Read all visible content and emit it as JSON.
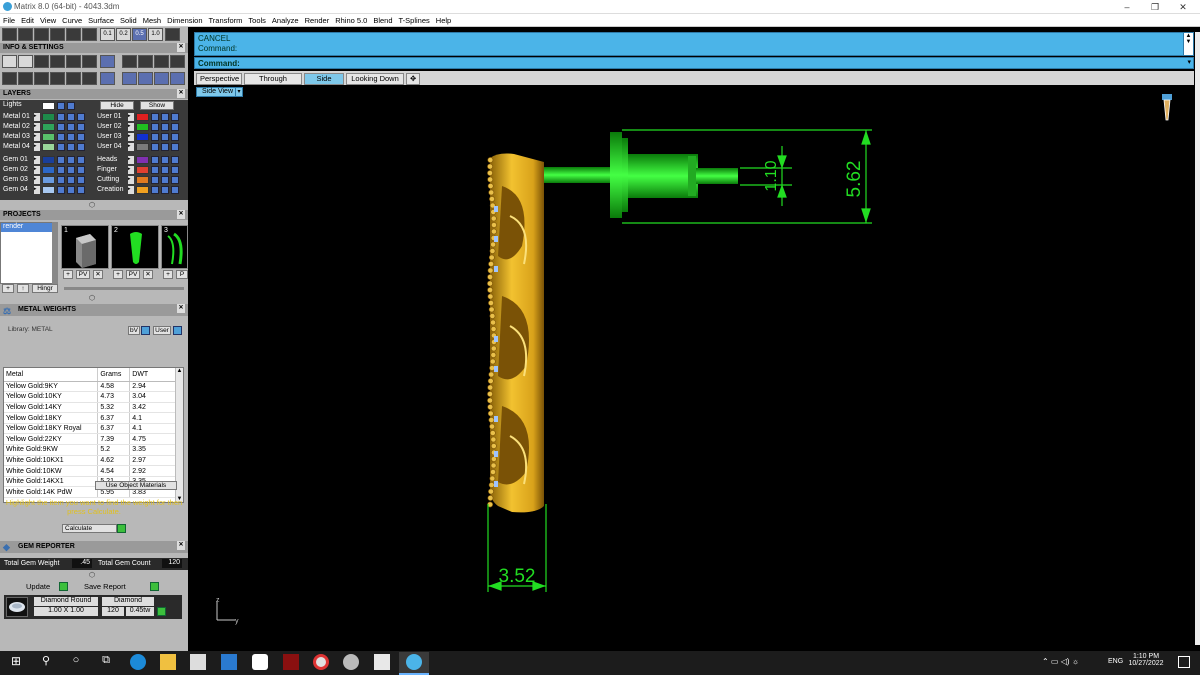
{
  "window": {
    "title": "Matrix 8.0 (64-bit) - 4043.3dm",
    "controls": [
      "–",
      "❐",
      "✕"
    ]
  },
  "menu": [
    "File",
    "Edit",
    "View",
    "Curve",
    "Surface",
    "Solid",
    "Mesh",
    "Dimension",
    "Transform",
    "Tools",
    "Analyze",
    "Render",
    "Rhino 5.0",
    "Blend",
    "T-Splines",
    "Help"
  ],
  "toolbar_numbers": [
    "0.1",
    "0.2",
    "0.5",
    "1.0"
  ],
  "info_settings": {
    "title": "INFO & SETTINGS"
  },
  "layers": {
    "title": "LAYERS",
    "lights_label": "Lights",
    "hide_label": "Hide",
    "show_label": "Show",
    "left": [
      {
        "name": "Metal 01",
        "color": "#1e8a4a"
      },
      {
        "name": "Metal 02",
        "color": "#2fa35a"
      },
      {
        "name": "Metal 03",
        "color": "#59c06a"
      },
      {
        "name": "Metal 04",
        "color": "#9ad89a"
      },
      {
        "name": "Gem 01",
        "color": "#1a3f9a"
      },
      {
        "name": "Gem 02",
        "color": "#2d68c8"
      },
      {
        "name": "Gem 03",
        "color": "#6a9be0"
      },
      {
        "name": "Gem 04",
        "color": "#a8c8f0"
      }
    ],
    "right": [
      {
        "name": "User 01",
        "color": "#e02020"
      },
      {
        "name": "User 02",
        "color": "#20c020"
      },
      {
        "name": "User 03",
        "color": "#1030d0"
      },
      {
        "name": "User 04",
        "color": "#7a7a7a"
      },
      {
        "name": "Heads",
        "color": "#8030b0"
      },
      {
        "name": "Finger",
        "color": "#e04030"
      },
      {
        "name": "Cutting",
        "color": "#e07a20"
      },
      {
        "name": "Creation",
        "color": "#f0a020"
      }
    ]
  },
  "projects": {
    "title": "PROJECTS",
    "list": [
      "render"
    ],
    "thumb_numbers": [
      "1",
      "2",
      "3"
    ],
    "bottom_button": "Hingr"
  },
  "metal_weights": {
    "title": "METAL WEIGHTS",
    "library_label": "Library: METAL",
    "user_label": "User",
    "columns": [
      "Metal",
      "Grams",
      "DWT"
    ],
    "rows": [
      [
        "Yellow Gold:9KY",
        "4.58",
        "2.94"
      ],
      [
        "Yellow Gold:10KY",
        "4.73",
        "3.04"
      ],
      [
        "Yellow Gold:14KY",
        "5.32",
        "3.42"
      ],
      [
        "Yellow Gold:18KY",
        "6.37",
        "4.1"
      ],
      [
        "Yellow Gold:18KY Royal",
        "6.37",
        "4.1"
      ],
      [
        "Yellow Gold:22KY",
        "7.39",
        "4.75"
      ],
      [
        "White Gold:9KW",
        "5.2",
        "3.35"
      ],
      [
        "White Gold:10KX1",
        "4.62",
        "2.97"
      ],
      [
        "White Gold:10KW",
        "4.54",
        "2.92"
      ],
      [
        "White Gold:14KX1",
        "5.21",
        "3.35"
      ],
      [
        "White Gold:14K PdW",
        "5.95",
        "3.83"
      ]
    ],
    "use_object_materials": "Use Object Materials",
    "hint": "Highlight the item you want to find the weight for then press Calculate.",
    "calculate_label": "Calculate"
  },
  "gem_reporter": {
    "title": "GEM REPORTER",
    "total_weight_label": "Total Gem Weight",
    "total_weight": ".45",
    "total_count_label": "Total Gem Count",
    "total_count": "120",
    "update_label": "Update",
    "save_report_label": "Save Report",
    "row": {
      "shape": "Diamond Round",
      "material": "Diamond",
      "size": "1.00 X 1.00",
      "count": "120",
      "weight": "0.45tw"
    }
  },
  "command": {
    "line1": "CANCEL",
    "line2": "Command:",
    "prompt": "Command:"
  },
  "viewport_tabs": [
    "Perspective",
    "Through Finger",
    "Side View",
    "Looking Down"
  ],
  "active_tab": "Side View",
  "viewport_label": "Side View",
  "dimensions": {
    "height": "5.62",
    "small": "1.10",
    "width": "3.52"
  },
  "axis_labels": {
    "z": "z",
    "y": "y"
  },
  "colors": {
    "command_bg": "#4bb4e8",
    "dimension": "#22dd22",
    "gold": "#e6b828"
  },
  "taskbar": {
    "time": "1:10 PM",
    "date": "10/27/2022",
    "lang": "ENG",
    "icons": [
      "windows-icon",
      "search-icon",
      "cortana-icon",
      "task-view-icon",
      "edge-icon",
      "file-explorer-icon",
      "store-icon",
      "mail-icon",
      "zoom-icon",
      "app-icon",
      "chrome-icon",
      "matrix-app-icon",
      "rhino-icon",
      "matrix-active-icon"
    ]
  }
}
